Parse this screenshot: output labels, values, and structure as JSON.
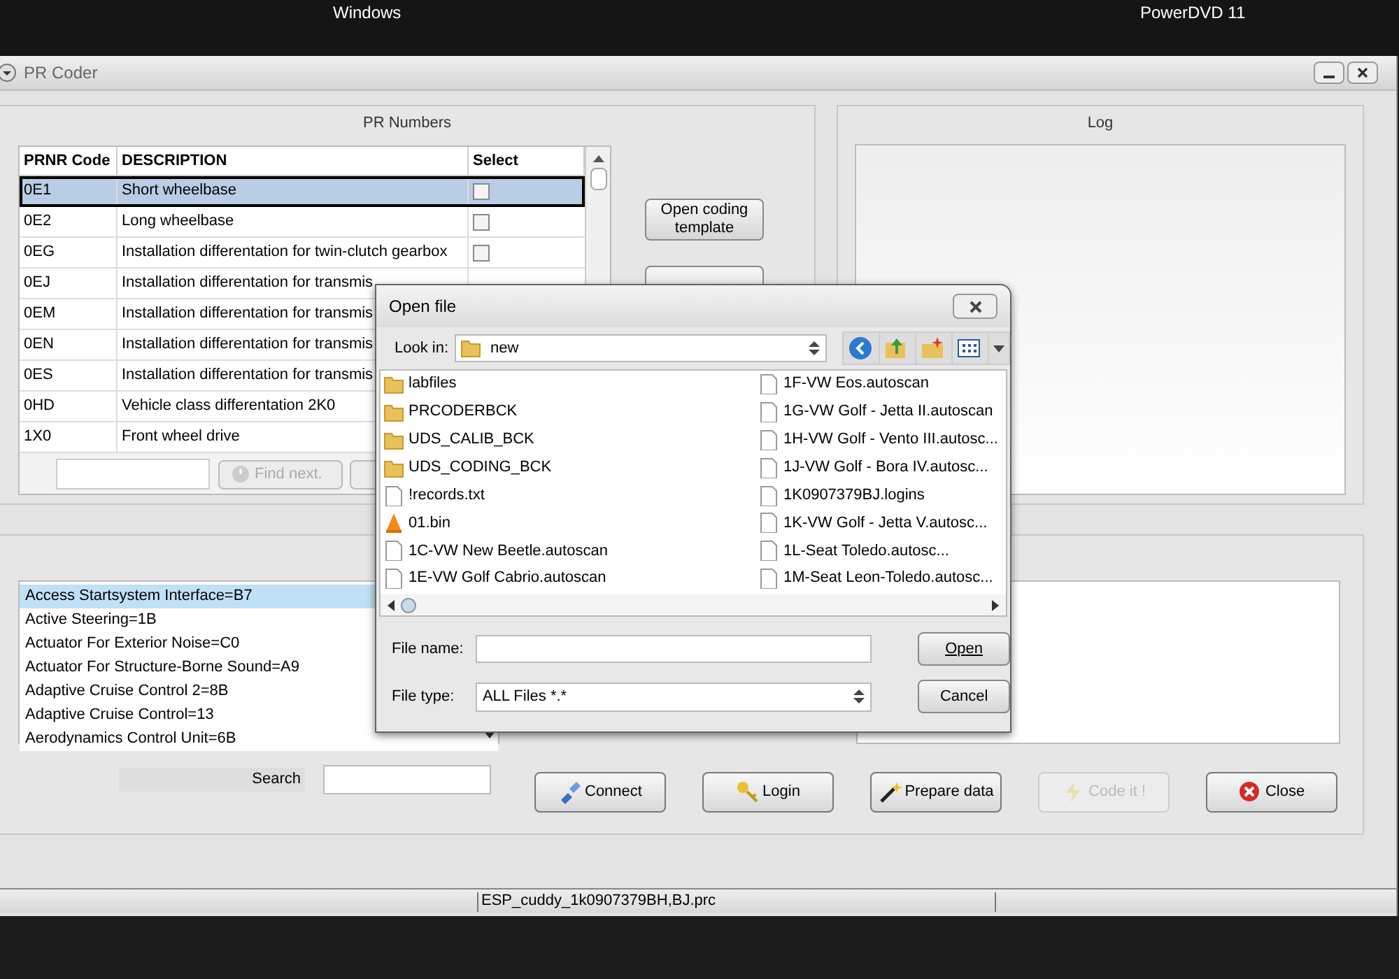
{
  "desktop": {
    "labels": [
      "Windows",
      "PowerDVD 11"
    ]
  },
  "window": {
    "title": "PR Coder"
  },
  "pr_numbers": {
    "title": "PR Numbers",
    "columns": [
      "PRNR Code",
      "DESCRIPTION",
      "Select"
    ],
    "rows": [
      {
        "code": "0E1",
        "description": "Short wheelbase",
        "selected": true,
        "checked": false
      },
      {
        "code": "0E2",
        "description": "Long wheelbase",
        "selected": false,
        "checked": false
      },
      {
        "code": "0EG",
        "description": "Installation differentation for twin-clutch gearbox",
        "selected": false,
        "checked": false
      },
      {
        "code": "0EJ",
        "description": "Installation differentation for transmis",
        "selected": false
      },
      {
        "code": "0EM",
        "description": "Installation differentation for transmis",
        "selected": false
      },
      {
        "code": "0EN",
        "description": "Installation differentation for transmis",
        "selected": false
      },
      {
        "code": "0ES",
        "description": "Installation differentation for transmis",
        "selected": false
      },
      {
        "code": "0HD",
        "description": "Vehicle class differentation 2K0",
        "selected": false
      },
      {
        "code": "1X0",
        "description": "Front wheel drive",
        "selected": false
      }
    ],
    "find_button": {
      "label": "Find next.",
      "disabled": true
    },
    "open_template_button": "Open coding template"
  },
  "log": {
    "title": "Log"
  },
  "control_units": {
    "items": [
      {
        "label": "Access Startsystem Interface=B7",
        "selected": true
      },
      {
        "label": "Active Steering=1B",
        "selected": false
      },
      {
        "label": "Actuator For Exterior Noise=C0",
        "selected": false
      },
      {
        "label": "Actuator For Structure-Borne Sound=A9",
        "selected": false
      },
      {
        "label": "Adaptive Cruise Control 2=8B",
        "selected": false
      },
      {
        "label": "Adaptive Cruise Control=13",
        "selected": false
      },
      {
        "label": "Aerodynamics Control Unit=6B",
        "selected": false
      }
    ],
    "search_label": "Search"
  },
  "buttons": [
    {
      "label": "Connect",
      "disabled": false
    },
    {
      "label": "Login",
      "disabled": false
    },
    {
      "label": "Prepare data",
      "disabled": false
    },
    {
      "label": "Code it !",
      "disabled": true
    },
    {
      "label": "Close",
      "disabled": false
    }
  ],
  "status_bar": {
    "file": "ESP_cuddy_1k0907379BH,BJ.prc"
  },
  "dialog": {
    "title": "Open file",
    "look_in_label": "Look in:",
    "look_in_value": "new",
    "files": [
      {
        "name": "labfiles",
        "kind": "folder"
      },
      {
        "name": "PRCODERBCK",
        "kind": "folder"
      },
      {
        "name": "UDS_CALIB_BCK",
        "kind": "folder"
      },
      {
        "name": "UDS_CODING_BCK",
        "kind": "folder"
      },
      {
        "name": "!records.txt",
        "kind": "file"
      },
      {
        "name": "01.bin",
        "kind": "media"
      },
      {
        "name": "1C-VW New Beetle.autoscan",
        "kind": "file"
      },
      {
        "name": "1E-VW Golf Cabrio.autoscan",
        "kind": "file"
      },
      {
        "name": "1F-VW Eos.autoscan",
        "kind": "file"
      },
      {
        "name": "1G-VW Golf - Jetta II.autoscan",
        "kind": "file"
      },
      {
        "name": "1H-VW Golf - Vento III.autosc...",
        "kind": "file"
      },
      {
        "name": "1J-VW Golf - Bora IV.autosc...",
        "kind": "file"
      },
      {
        "name": "1K0907379BJ.logins",
        "kind": "file"
      },
      {
        "name": "1K-VW Golf - Jetta V.autosc...",
        "kind": "file"
      },
      {
        "name": "1L-Seat Toledo.autosc...",
        "kind": "file"
      },
      {
        "name": "1M-Seat Leon-Toledo.autosc...",
        "kind": "file"
      }
    ],
    "file_name_label": "File name:",
    "file_type_label": "File type:",
    "file_type_value": "ALL Files *.*",
    "open_button": "Open",
    "cancel_button": "Cancel"
  }
}
